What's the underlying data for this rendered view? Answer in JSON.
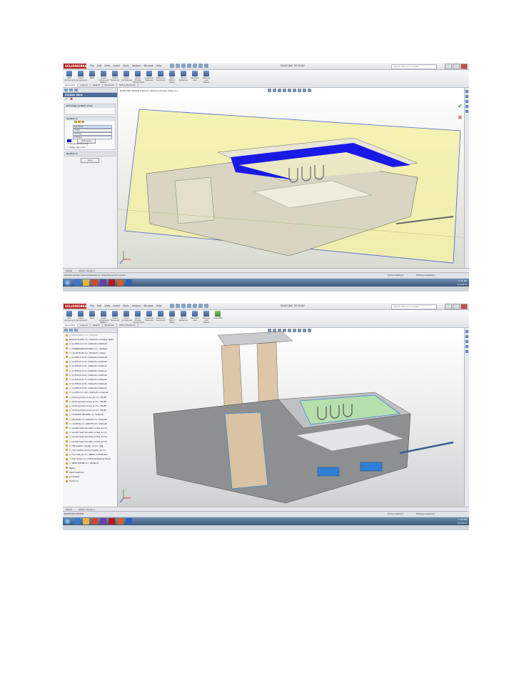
{
  "app": {
    "logo": "SOLIDWORKS",
    "menus": [
      "File",
      "Edit",
      "View",
      "Insert",
      "Tools",
      "Toolbox",
      "Window",
      "Help"
    ],
    "search_placeholder": "Search files and models",
    "document_title": "BASELINE DESIGN*",
    "tabs": [
      "Assembly",
      "Layout",
      "Sketch",
      "Evaluate",
      "Office Products"
    ],
    "model_tabs": [
      "Model",
      "Motion Study 1"
    ],
    "status_defined": "Under Defined",
    "status_editing": "Editing Assembly",
    "status_units": "IPS",
    "clock_time": "3:45 PM",
    "clock_date": "2/1/2013"
  },
  "toolbar1": [
    "Edit Component",
    "Insert Components",
    "Mate",
    "Linear Component Pattern",
    "Smart Fasteners",
    "Move Component",
    "Show Hidden Components",
    "Assembly Features",
    "Reference Geometry",
    "New Motion Study",
    "Bill of Materials",
    "Exploded View",
    "Explode Line Sketch"
  ],
  "toolbar2": [
    "Edit Component",
    "Insert Components",
    "Mate",
    "Linear Component Pattern",
    "Smart Fasteners",
    "Move Component",
    "Show Hidden Components",
    "Assembly Features",
    "Reference Geometry",
    "New Motion Study",
    "Bill of Materials",
    "Exploded View",
    "Explode Line Sketch",
    "Instant3D"
  ],
  "section_panel": {
    "title": "Section View",
    "message_group": "Drawing section view",
    "section1": "Section 1",
    "plane": "Top Plane",
    "offset": "0.00in",
    "angle_x": "0.00deg",
    "angle_y": "0.00deg",
    "edit_color": "Edit Color",
    "show_section_cap": "Show section cap",
    "keep_cap_color": "Keep cap color",
    "section2": "Section 2",
    "save_button": "Save"
  },
  "breadcrumb": "BASELINE DESIGN (Default<Default_Display State-1>)",
  "status_message_1": "Set the section view properties or drag the section plane",
  "status_message_2": "BASELINE DESIGN",
  "tree": [
    "(-) 000-000[1] <1> (Default)",
    "Bracket PLATE<1> (Default<<Display State",
    "(-) Q-25513-2<1> (Default<<Default",
    "(-) EXPANSION-HOUSING<1> (Default",
    "(-) 10-0470-00<1> (Default<<Displ",
    "(-) Q-25513-2<2> (Default<<Default",
    "(-) Q-25513-2<3> (Default<<Default",
    "(-) Q-25513-2<4> (Default<<Default",
    "(-) Q-25513-2<5> (Default<<Default",
    "(-) Q-25513-2<6> (Default<<Default",
    "(-) Q-25513-2<7> (Default<<Default",
    "(-) Q-25513-2<8> (Default<<Default",
    "(-) Q-25513-2<9> (Default<<Default",
    "(-) Q-25513-2<10> (Default<<Default",
    "(-) binding head screw_ai<1> (3R-8H",
    "(-) binding head screw_ai<2> (3R-8H",
    "(-) binding head screw_ai<3> (3R-8H",
    "(-) binding head screw_ai<4> (3R-8H",
    "(-) 5715025 TRAILER<1> (Default",
    "(-) 00-0540<1> 604035<1> (Default",
    "(-) 10-0540<1> 604035<2> (Default",
    "(-) socket head shoulder screw_ai<1>",
    "(-) socket head shoulder screw_ai<2>",
    "(-) socket head shoulder screw_ai<3>",
    "(-) socket head shoulder screw_ai<4>",
    "(-) flat washer regular_ai<1> (3/8",
    "(-) lock washer spring regular_ai<1>",
    "(-) hex bolt_ai<1> (HBOLT 0.2500-20x",
    "(-) top clamp<1> (Default<Display State",
    "(-) NEW-FOILER<1> (Default)",
    "Mates",
    "Swell Features",
    "Lock-Meth",
    "Section1"
  ]
}
